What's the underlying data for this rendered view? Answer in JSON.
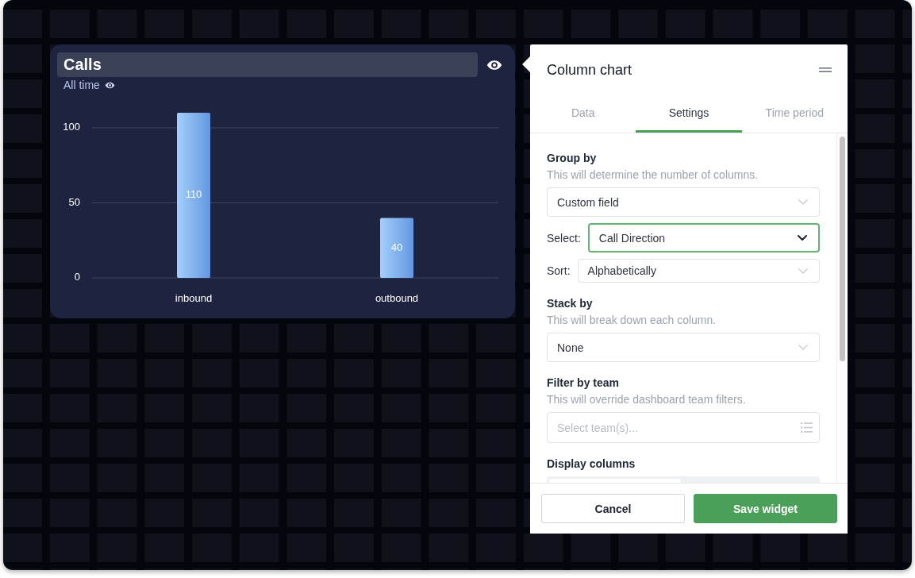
{
  "chart_card": {
    "title": "Calls",
    "subtitle": "All time",
    "chart_data": {
      "type": "bar",
      "categories": [
        "inbound",
        "outbound"
      ],
      "values": [
        110,
        40
      ],
      "ylim": [
        0,
        110
      ],
      "yticks": [
        0,
        50,
        100
      ],
      "data_labels": true
    }
  },
  "panel": {
    "title": "Column chart",
    "tabs": [
      {
        "label": "Data",
        "selected": false
      },
      {
        "label": "Settings",
        "selected": true
      },
      {
        "label": "Time period",
        "selected": false
      }
    ],
    "sections": [
      {
        "heading": "Group by",
        "description": "This will determine the number of columns.",
        "fields": [
          {
            "kind": "select",
            "value": "Custom field",
            "focused": false
          },
          {
            "kind": "select",
            "label": "Select:",
            "value": "Call Direction",
            "focused": true
          },
          {
            "kind": "select",
            "label": "Sort:",
            "value": "Alphabetically",
            "focused": false
          }
        ]
      },
      {
        "heading": "Stack by",
        "description": "This will break down each column.",
        "fields": [
          {
            "kind": "select",
            "value": "None",
            "focused": false
          }
        ]
      },
      {
        "heading": "Filter by team",
        "description": "This will override dashboard team filters.",
        "fields": [
          {
            "kind": "multiselect",
            "placeholder": "Select team(s)..."
          }
        ]
      },
      {
        "heading": "Display columns",
        "fields": [
          {
            "kind": "segmented"
          }
        ]
      }
    ],
    "buttons": [
      {
        "label": "Cancel",
        "kind": "secondary"
      },
      {
        "label": "Save widget",
        "kind": "primary"
      }
    ]
  }
}
